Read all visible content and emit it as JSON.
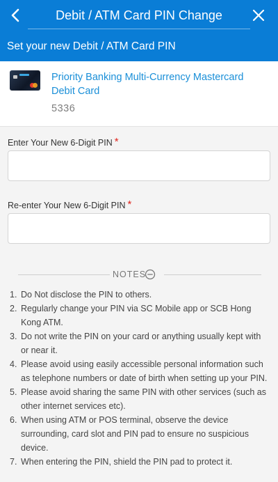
{
  "header": {
    "title": "Debit / ATM Card PIN Change",
    "subtitle": "Set your new Debit / ATM Card PIN",
    "back_icon": "chevron-left-icon",
    "close_icon": "close-icon",
    "background_color": "#0a7dd6"
  },
  "card": {
    "name": "Priority Banking Multi-Currency Mastercard Debit Card",
    "number": "5336"
  },
  "form": {
    "new_pin_label": "Enter Your New 6-Digit PIN",
    "confirm_pin_label": "Re-enter Your New 6-Digit PIN",
    "required_mark": "*",
    "new_pin_value": "",
    "confirm_pin_value": ""
  },
  "notes": {
    "heading": "NOTES",
    "toggle_icon": "collapse-minus-icon",
    "items": [
      {
        "num": "1.",
        "text": "Do Not disclose the PIN to others."
      },
      {
        "num": "2.",
        "text": "Regularly change your PIN via SC Mobile app or SCB Hong Kong ATM."
      },
      {
        "num": "3.",
        "text": "Do not write the PIN on your card or anything usually kept with or near it."
      },
      {
        "num": "4.",
        "text": "Please avoid using easily accessible personal information such as telephone numbers or date of birth when setting up your PIN."
      },
      {
        "num": "5.",
        "text": "Please avoid sharing the same PIN with other services (such as other internet services etc)."
      },
      {
        "num": "6.",
        "text": "When using ATM or POS terminal, observe the device surrounding, card slot and PIN pad to ensure no suspicious device."
      },
      {
        "num": "7.",
        "text": "When entering the PIN, shield the PIN pad to protect it."
      }
    ]
  }
}
